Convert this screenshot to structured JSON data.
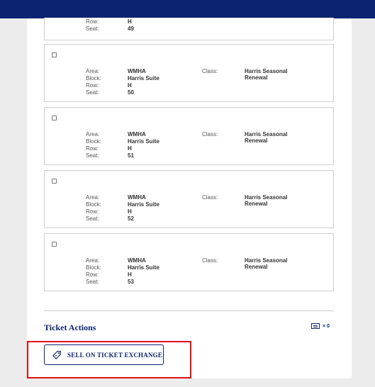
{
  "labels": {
    "area": "Area:",
    "block": "Block:",
    "row": "Row:",
    "seat": "Seat:",
    "class": "Class:"
  },
  "partial_ticket": {
    "row": "H",
    "seat": "49"
  },
  "tickets": [
    {
      "area": "WMHA",
      "block": "Harris Suite",
      "row": "H",
      "seat": "50",
      "class": "Harris Seasonal Renewal"
    },
    {
      "area": "WMHA",
      "block": "Harris Suite",
      "row": "H",
      "seat": "51",
      "class": "Harris Seasonal Renewal"
    },
    {
      "area": "WMHA",
      "block": "Harris Suite",
      "row": "H",
      "seat": "52",
      "class": "Harris Seasonal Renewal"
    },
    {
      "area": "WMHA",
      "block": "Harris Suite",
      "row": "H",
      "seat": "53",
      "class": "Harris Seasonal Renewal"
    }
  ],
  "ticket_actions": {
    "title": "Ticket Actions",
    "selected_count": "× 0",
    "sell_button_label": "SELL ON TICKET EXCHANGE"
  },
  "colors": {
    "brand_navy": "#0b2370",
    "highlight_red": "#e01010"
  },
  "icons": {
    "ticket": "ticket-icon",
    "sell": "tag-icon"
  }
}
